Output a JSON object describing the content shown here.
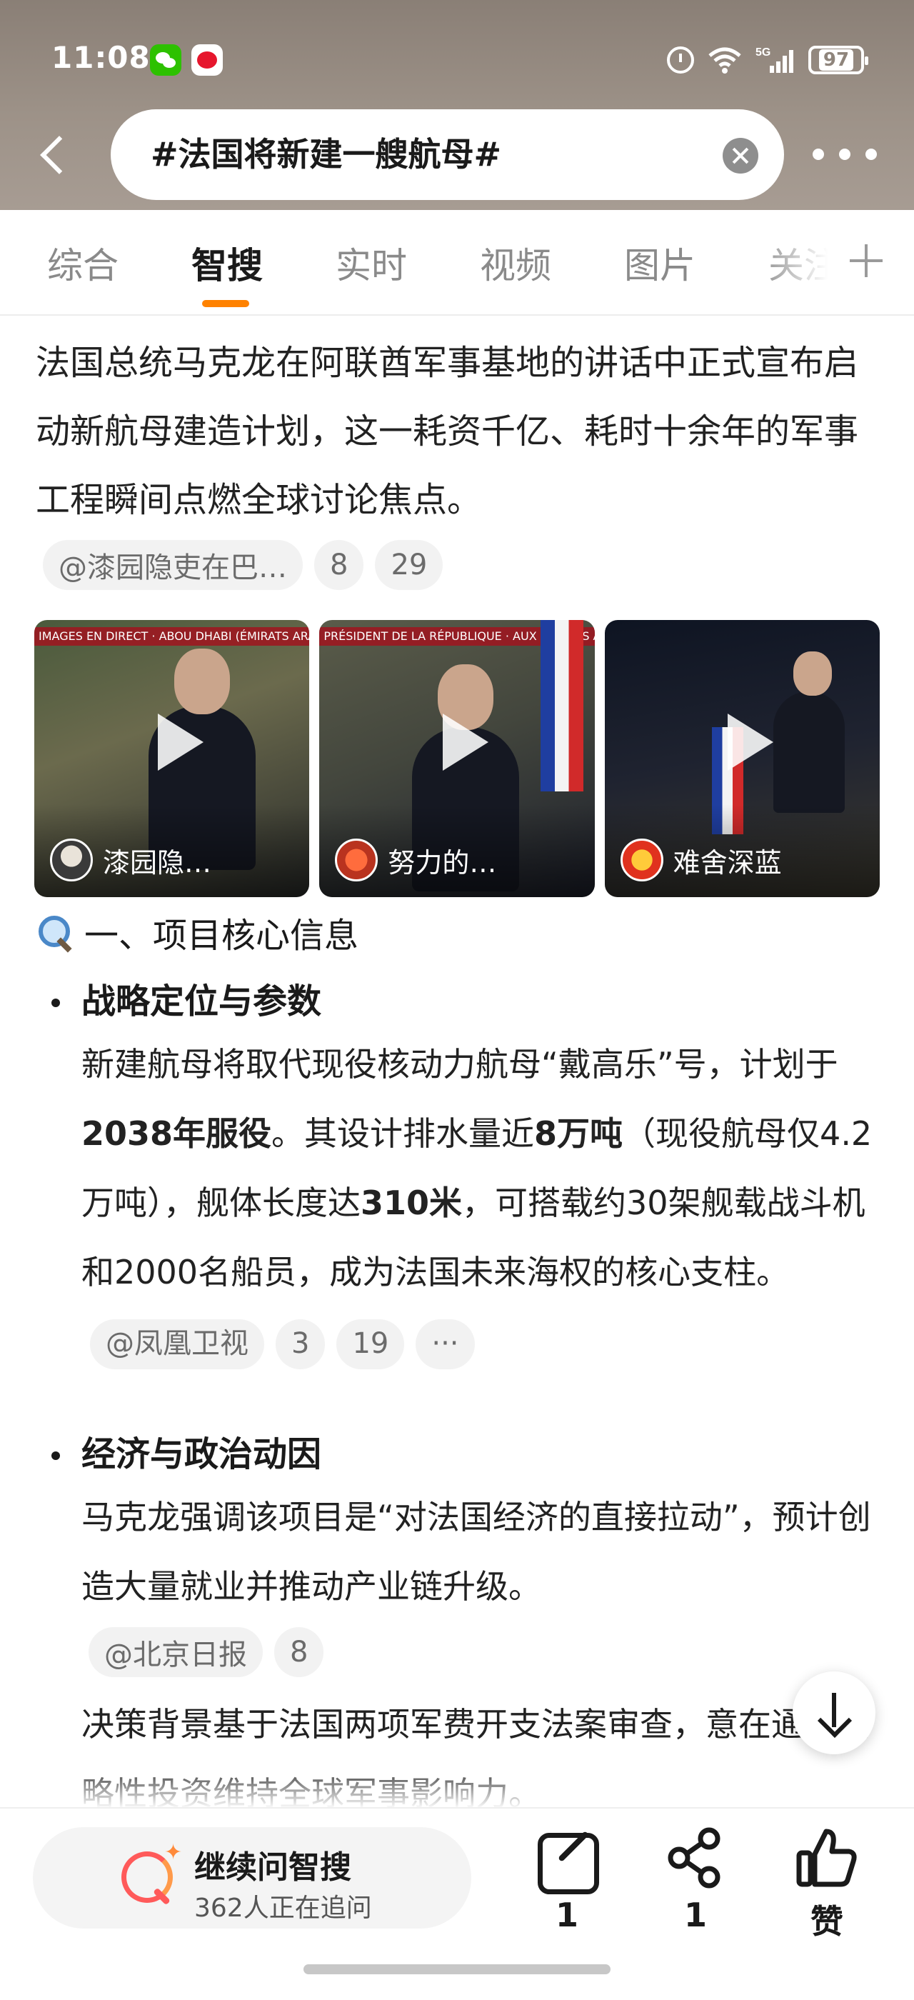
{
  "status": {
    "time": "11:08",
    "network": "5G",
    "battery": "97"
  },
  "search": {
    "query": "#法国将新建一艘航母#"
  },
  "tabs": [
    {
      "label": "综合"
    },
    {
      "label": "智搜"
    },
    {
      "label": "实时"
    },
    {
      "label": "视频"
    },
    {
      "label": "图片"
    },
    {
      "label": "关注"
    }
  ],
  "intro": {
    "text": "法国总统马克龙在阿联酋军事基地的讲话中正式宣布启动新航母建造计划，这一耗资千亿、耗时十余年的军事工程瞬间点燃全球讨论焦点。",
    "source": "@漆园隐吏在巴…",
    "count_a": "8",
    "count_b": "29"
  },
  "videos": [
    {
      "banner": "IMAGES EN DIRECT · ABOU DHABI (ÉMIRATS ARABES UNIS)",
      "user": "漆园隐…"
    },
    {
      "banner": "PRÉSIDENT DE LA RÉPUBLIQUE · AUX ÉMIRATS ARABES UNIS",
      "user": "努力的…"
    },
    {
      "banner": "",
      "user": "难舍深蓝"
    }
  ],
  "section": {
    "title": "一、项目核心信息"
  },
  "bullets": [
    {
      "heading": "战略定位与参数",
      "p1": "新建航母将取代现役核动力航母“戴高乐”号，计划于",
      "b1": "2038年服役",
      "p2": "。其设计排水量近",
      "b2": "8万吨",
      "p3": "（现役航母仅4.2万吨），舰体长度达",
      "b3": "310米",
      "p4": "，可搭载约30架舰载战斗机和2000名船员，成为法国未来海权的核心支柱。",
      "source": "@凤凰卫视",
      "count_a": "3",
      "count_b": "19",
      "more": "···"
    },
    {
      "heading": "经济与政治动因",
      "p1": "马克龙强调该项目是“对法国经济的直接拉动”，预计创造大量就业并推动产业链升级。",
      "source": "@北京日报",
      "count_a": "8",
      "p2": "决策背景基于法国两项军费开支法案审查，意在通过战略性投资维持全球军事影响力。"
    }
  ],
  "bottom": {
    "ask_title": "继续问智搜",
    "ask_sub": "362人正在追问",
    "comment_count": "1",
    "share_count": "1",
    "like_label": "赞"
  }
}
